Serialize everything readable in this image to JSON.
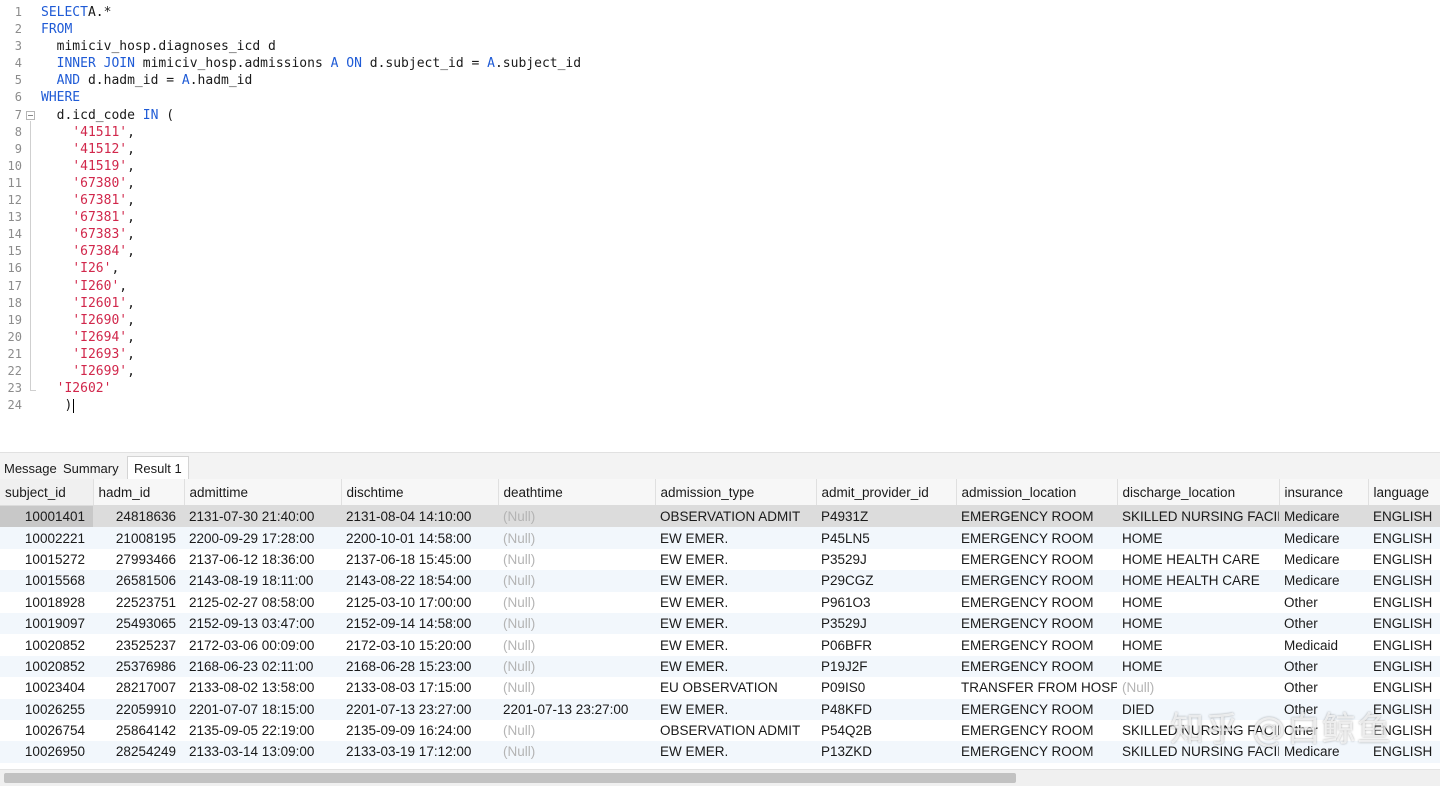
{
  "editor": {
    "line_numbers": [
      "1",
      "2",
      "3",
      "4",
      "5",
      "6",
      "7",
      "8",
      "9",
      "10",
      "11",
      "12",
      "13",
      "14",
      "15",
      "16",
      "17",
      "18",
      "19",
      "20",
      "21",
      "22",
      "23",
      "24"
    ],
    "lines": [
      [
        [
          "kw",
          "SELECT"
        ],
        [
          "",
          "A.*"
        ]
      ],
      [
        [
          "kw",
          "FROM"
        ]
      ],
      [
        [
          "",
          "  mimiciv_hosp.diagnoses_icd d"
        ]
      ],
      [
        [
          "",
          "  "
        ],
        [
          "kw",
          "INNER JOIN"
        ],
        [
          "",
          " mimiciv_hosp.admissions "
        ],
        [
          "kw",
          "A ON"
        ],
        [
          "",
          " d.subject_id = "
        ],
        [
          "kw",
          "A"
        ],
        [
          "",
          ".subject_id"
        ]
      ],
      [
        [
          "",
          "  "
        ],
        [
          "kw",
          "AND"
        ],
        [
          "",
          " d.hadm_id = "
        ],
        [
          "kw",
          "A"
        ],
        [
          "",
          ".hadm_id"
        ]
      ],
      [
        [
          "kw",
          "WHERE"
        ]
      ],
      [
        [
          "",
          "  d.icd_code "
        ],
        [
          "kw",
          "IN"
        ],
        [
          "",
          " ("
        ]
      ],
      [
        [
          "",
          "    "
        ],
        [
          "st",
          "'41511'"
        ],
        [
          "",
          ","
        ]
      ],
      [
        [
          "",
          "    "
        ],
        [
          "st",
          "'41512'"
        ],
        [
          "",
          ","
        ]
      ],
      [
        [
          "",
          "    "
        ],
        [
          "st",
          "'41519'"
        ],
        [
          "",
          ","
        ]
      ],
      [
        [
          "",
          "    "
        ],
        [
          "st",
          "'67380'"
        ],
        [
          "",
          ","
        ]
      ],
      [
        [
          "",
          "    "
        ],
        [
          "st",
          "'67381'"
        ],
        [
          "",
          ","
        ]
      ],
      [
        [
          "",
          "    "
        ],
        [
          "st",
          "'67381'"
        ],
        [
          "",
          ","
        ]
      ],
      [
        [
          "",
          "    "
        ],
        [
          "st",
          "'67383'"
        ],
        [
          "",
          ","
        ]
      ],
      [
        [
          "",
          "    "
        ],
        [
          "st",
          "'67384'"
        ],
        [
          "",
          ","
        ]
      ],
      [
        [
          "",
          "    "
        ],
        [
          "st",
          "'I26'"
        ],
        [
          "",
          ","
        ]
      ],
      [
        [
          "",
          "    "
        ],
        [
          "st",
          "'I260'"
        ],
        [
          "",
          ","
        ]
      ],
      [
        [
          "",
          "    "
        ],
        [
          "st",
          "'I2601'"
        ],
        [
          "",
          ","
        ]
      ],
      [
        [
          "",
          "    "
        ],
        [
          "st",
          "'I2690'"
        ],
        [
          "",
          ","
        ]
      ],
      [
        [
          "",
          "    "
        ],
        [
          "st",
          "'I2694'"
        ],
        [
          "",
          ","
        ]
      ],
      [
        [
          "",
          "    "
        ],
        [
          "st",
          "'I2693'"
        ],
        [
          "",
          ","
        ]
      ],
      [
        [
          "",
          "    "
        ],
        [
          "st",
          "'I2699'"
        ],
        [
          "",
          ","
        ]
      ],
      [
        [
          "",
          "  "
        ],
        [
          "st",
          "'I2602'"
        ]
      ],
      [
        [
          "",
          "   )"
        ]
      ]
    ]
  },
  "tabs": [
    {
      "id": "message",
      "label": "Message"
    },
    {
      "id": "summary",
      "label": "Summary"
    },
    {
      "id": "result1",
      "label": "Result 1"
    }
  ],
  "active_tab": "result1",
  "grid": {
    "columns": [
      "subject_id",
      "hadm_id",
      "admittime",
      "dischtime",
      "deathtime",
      "admission_type",
      "admit_provider_id",
      "admission_location",
      "discharge_location",
      "insurance",
      "language"
    ],
    "null_text": "(Null)",
    "rows": [
      [
        "10001401",
        "24818636",
        "2131-07-30 21:40:00",
        "2131-08-04 14:10:00",
        null,
        "OBSERVATION ADMIT",
        "P4931Z",
        "EMERGENCY ROOM",
        "SKILLED NURSING FACIL",
        "Medicare",
        "ENGLISH"
      ],
      [
        "10002221",
        "21008195",
        "2200-09-29 17:28:00",
        "2200-10-01 14:58:00",
        null,
        "EW EMER.",
        "P45LN5",
        "EMERGENCY ROOM",
        "HOME",
        "Medicare",
        "ENGLISH"
      ],
      [
        "10015272",
        "27993466",
        "2137-06-12 18:36:00",
        "2137-06-18 15:45:00",
        null,
        "EW EMER.",
        "P3529J",
        "EMERGENCY ROOM",
        "HOME HEALTH CARE",
        "Medicare",
        "ENGLISH"
      ],
      [
        "10015568",
        "26581506",
        "2143-08-19 18:11:00",
        "2143-08-22 18:54:00",
        null,
        "EW EMER.",
        "P29CGZ",
        "EMERGENCY ROOM",
        "HOME HEALTH CARE",
        "Medicare",
        "ENGLISH"
      ],
      [
        "10018928",
        "22523751",
        "2125-02-27 08:58:00",
        "2125-03-10 17:00:00",
        null,
        "EW EMER.",
        "P961O3",
        "EMERGENCY ROOM",
        "HOME",
        "Other",
        "ENGLISH"
      ],
      [
        "10019097",
        "25493065",
        "2152-09-13 03:47:00",
        "2152-09-14 14:58:00",
        null,
        "EW EMER.",
        "P3529J",
        "EMERGENCY ROOM",
        "HOME",
        "Other",
        "ENGLISH"
      ],
      [
        "10020852",
        "23525237",
        "2172-03-06 00:09:00",
        "2172-03-10 15:20:00",
        null,
        "EW EMER.",
        "P06BFR",
        "EMERGENCY ROOM",
        "HOME",
        "Medicaid",
        "ENGLISH"
      ],
      [
        "10020852",
        "25376986",
        "2168-06-23 02:11:00",
        "2168-06-28 15:23:00",
        null,
        "EW EMER.",
        "P19J2F",
        "EMERGENCY ROOM",
        "HOME",
        "Other",
        "ENGLISH"
      ],
      [
        "10023404",
        "28217007",
        "2133-08-02 13:58:00",
        "2133-08-03 17:15:00",
        null,
        "EU OBSERVATION",
        "P09IS0",
        "TRANSFER FROM HOSPI",
        null,
        "Other",
        "ENGLISH"
      ],
      [
        "10026255",
        "22059910",
        "2201-07-07 18:15:00",
        "2201-07-13 23:27:00",
        "2201-07-13 23:27:00",
        "EW EMER.",
        "P48KFD",
        "EMERGENCY ROOM",
        "DIED",
        "Other",
        "ENGLISH"
      ],
      [
        "10026754",
        "25864142",
        "2135-09-05 22:19:00",
        "2135-09-09 16:24:00",
        null,
        "OBSERVATION ADMIT",
        "P54Q2B",
        "EMERGENCY ROOM",
        "SKILLED NURSING FACIL",
        "Other",
        "ENGLISH"
      ],
      [
        "10026950",
        "28254249",
        "2133-03-14 13:09:00",
        "2133-03-19 17:12:00",
        null,
        "EW EMER.",
        "P13ZKD",
        "EMERGENCY ROOM",
        "SKILLED NURSING FACIL",
        "Medicare",
        "ENGLISH"
      ]
    ],
    "selected_row": 0
  },
  "watermark": "知乎 @白鲸鱼"
}
